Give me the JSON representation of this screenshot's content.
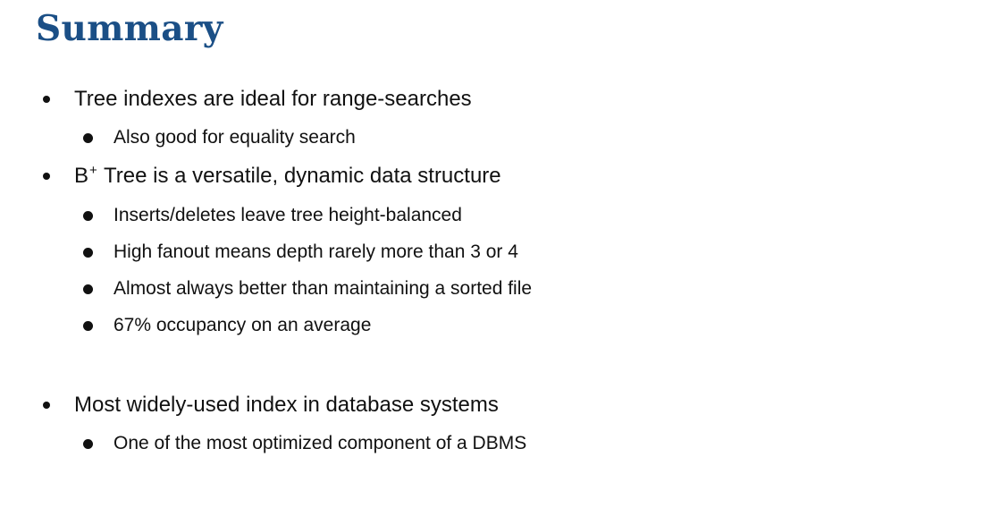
{
  "slide": {
    "title": "Summary",
    "bullets": [
      {
        "text": "Tree indexes are ideal for range-searches",
        "children": [
          "Also good for equality search"
        ]
      },
      {
        "prefix": "B",
        "superscript": "+",
        "text": " Tree is a versatile, dynamic data structure",
        "children": [
          "Inserts/deletes leave tree height-balanced",
          "High fanout means depth rarely more than 3 or 4",
          "Almost always better than maintaining a sorted file",
          "67% occupancy on an average"
        ]
      },
      {
        "text": "Most widely-used index in database systems",
        "children": [
          "One of the most optimized component of a DBMS"
        ]
      }
    ]
  },
  "colors": {
    "title": "#1b4f86",
    "text": "#111111",
    "background": "#ffffff"
  }
}
